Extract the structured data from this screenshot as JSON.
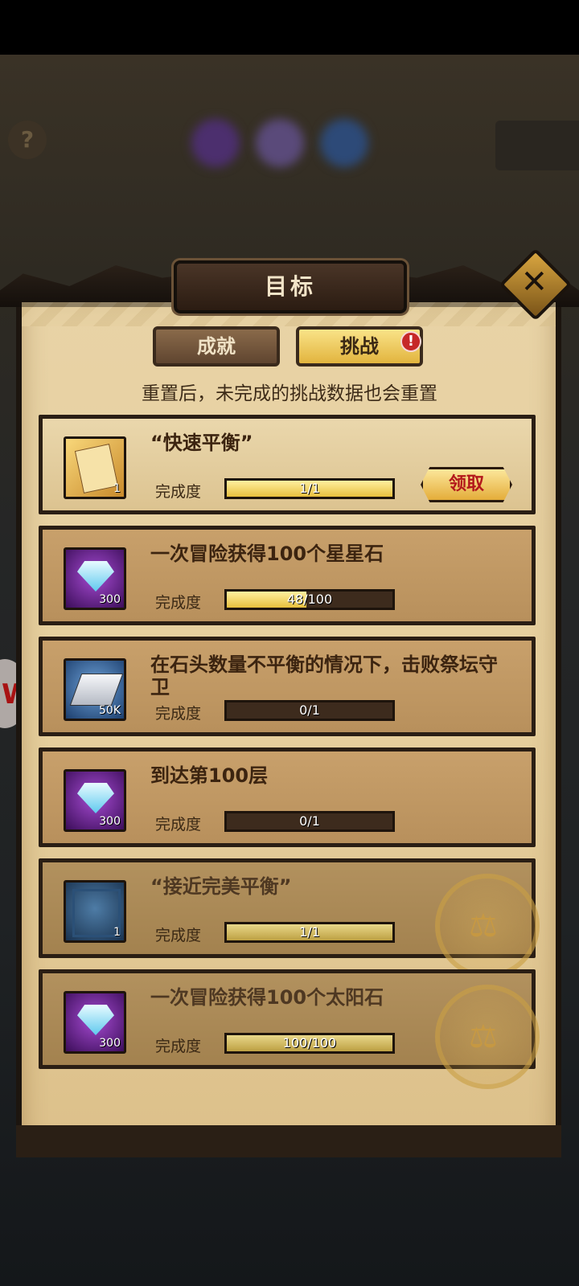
{
  "dialog": {
    "title": "目标",
    "close_icon": "close-icon",
    "tabs": [
      {
        "label": "成就",
        "selected": false
      },
      {
        "label": "挑战",
        "selected": true,
        "badge": "!"
      }
    ],
    "notice": "重置后，未完成的挑战数据也会重置",
    "progress_label": "完成度",
    "claim_label": "领取"
  },
  "challenges": [
    {
      "title": "“快速平衡”",
      "reward_icon": "letter-icon",
      "reward_count": "1",
      "progress_text": "1/1",
      "progress": 1.0,
      "state": "claimable"
    },
    {
      "title": "一次冒险获得100个星星石",
      "reward_icon": "gem-icon",
      "reward_count": "300",
      "progress_text": "48/100",
      "progress": 0.48,
      "state": "in-progress"
    },
    {
      "title": "在石头数量不平衡的情况下，击败祭坛守卫",
      "reward_icon": "tablet-icon",
      "reward_count": "50K",
      "progress_text": "0/1",
      "progress": 0.0,
      "state": "in-progress"
    },
    {
      "title": "到达第100层",
      "reward_icon": "gem-icon",
      "reward_count": "300",
      "progress_text": "0/1",
      "progress": 0.0,
      "state": "in-progress"
    },
    {
      "title": "“接近完美平衡”",
      "reward_icon": "frame-icon",
      "reward_count": "1",
      "progress_text": "1/1",
      "progress": 1.0,
      "state": "claimed"
    },
    {
      "title": "一次冒险获得100个太阳石",
      "reward_icon": "gem-icon",
      "reward_count": "300",
      "progress_text": "100/100",
      "progress": 1.0,
      "state": "claimed"
    }
  ]
}
